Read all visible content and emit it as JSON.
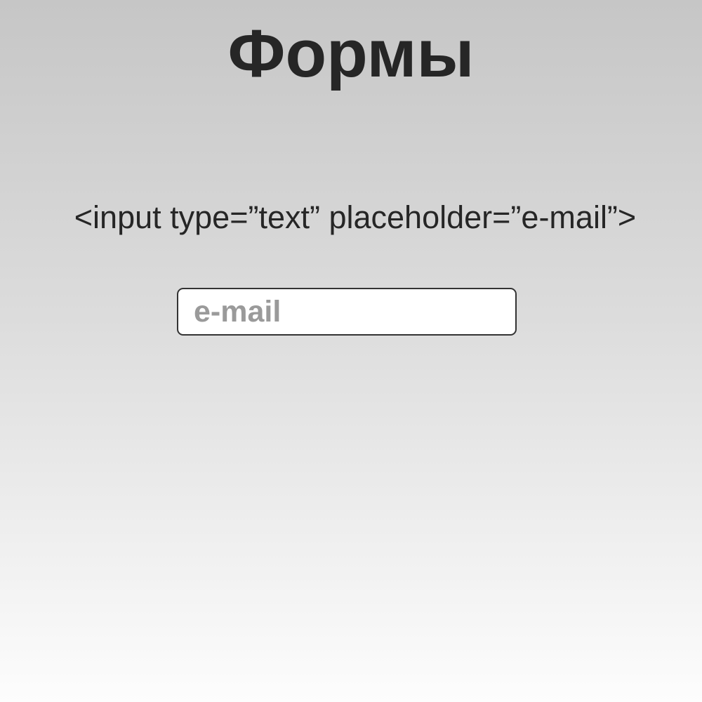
{
  "slide": {
    "title": "Формы"
  },
  "code": {
    "line": "<input type=”text” placeholder=”e-mail”>"
  },
  "email_input": {
    "value": "",
    "placeholder": "e-mail"
  },
  "colors": {
    "text": "#262626",
    "placeholder": "#9a9a9a",
    "input_border": "#333333",
    "input_background": "#ffffff"
  }
}
